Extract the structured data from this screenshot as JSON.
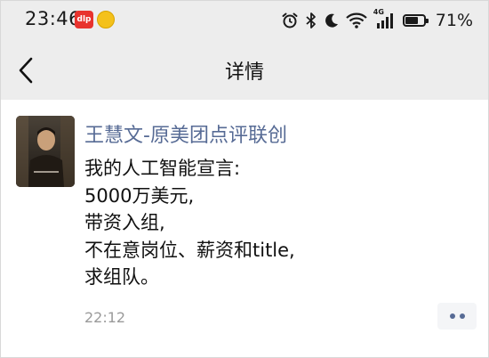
{
  "status_bar": {
    "time": "23:46",
    "notification_app_icon_text": "dlp",
    "network_label": "4G",
    "battery_percent": "71%",
    "battery_level": 0.71
  },
  "nav": {
    "title": "详情"
  },
  "post": {
    "author": "王慧文-原美团点评联创",
    "lines": [
      "我的人工智能宣言:",
      "5000万美元,",
      "带资入组,",
      "不在意岗位、薪资和title,",
      "求组队。"
    ],
    "time": "22:12"
  },
  "icons": {
    "back": "chevron-left-icon",
    "more": "more-dots-icon",
    "alarm": "alarm-icon",
    "bluetooth": "bluetooth-icon",
    "moon": "moon-icon",
    "wifi": "wifi-icon",
    "signal": "signal-icon",
    "battery": "battery-icon"
  },
  "colors": {
    "bar_background": "#ededed",
    "author_link": "#576b95",
    "timestamp": "#9a9a9a"
  }
}
